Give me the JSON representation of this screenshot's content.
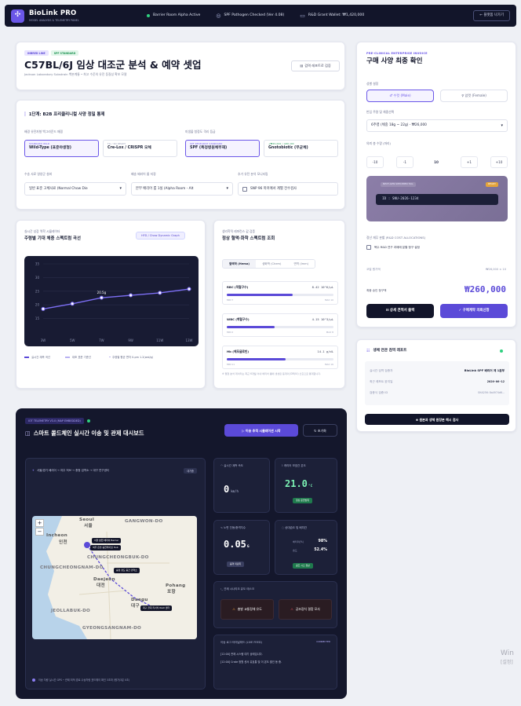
{
  "app": {
    "title": "BioLink PRO",
    "subtitle": "MODEL ANALYSIS & TELEMETRY PANEL",
    "status": [
      {
        "label": "Barrier Room Alpha Active",
        "icon": "status-dot"
      },
      {
        "label": "SPF Pathogen Checked (Ver 4.08)",
        "icon": "shield-check-icon"
      },
      {
        "label": "R&D Grant Wallet: ₩1,420,000",
        "icon": "wallet-icon"
      }
    ],
    "exit_label": "← 플랫폼 나가기"
  },
  "header": {
    "tags": [
      "INBRED LINE",
      "SPF STANDARD"
    ],
    "title": "C57BL/6J 임상 대조군 분석 & 예약 셋업",
    "subtitle": "Jackson Laboratory Substrain 백본계통 • 최고 수준의 유전 동질성 확보 모델",
    "report_button": "검역 레포트로 검증"
  },
  "step": {
    "title": "1단계: B2B 프리클리니컬 사양 정밀 통제",
    "genetic_label": "배경 유전자형 백그라운드 매핑",
    "genetic_options": [
      {
        "kicker": "STANDARD WILD",
        "value": "Wild-Type (표준야생형)",
        "selected": true
      },
      {
        "kicker": "TG / KO READY",
        "value": "Cre-Lox / CRISPR 모체",
        "selected": false
      }
    ],
    "micro_label": "미생물 청정도 격리 등급",
    "micro_options": [
      {
        "kicker": "SPF RESEARCH STANDARD",
        "value": "SPF (특정병원체부재)",
        "selected": true
      },
      {
        "kicker": "+₩45,000 / ADD-ON",
        "value": "Gnotobiotic (무균체)",
        "selected": false
      }
    ],
    "diet_label": "수송 사료 영양군 설비",
    "diet_value": "일반 표준 고체사료 (Normal Chow Die",
    "barrier_label": "배송 배리어 룸 지정",
    "barrier_value": "본부 배리어 룸 1실 (Alpha Room - Alt",
    "extra_label": "추가 유전 분석 모니터링",
    "extra_value": "SNP 96 마커에서 계별 전수검사"
  },
  "growth": {
    "kicker": "실시간 성장 역학 시뮬레이터",
    "title": "주령별 기대 체중 스펙트럼 곡선",
    "button": "HFD / Chow Dynamic Graph",
    "legend": [
      "실시간 계측 곡선",
      "대조 표준 기준선",
      "주령별 평균 편차 0-pm 1.2(wol/g)"
    ]
  },
  "chart_data": {
    "type": "line",
    "title": "주령별 기대 체중 스펙트럼 곡선",
    "x": [
      "3W",
      "5W",
      "7W",
      "9W",
      "11W",
      "13W"
    ],
    "y_ticks": [
      "35",
      "30",
      "25",
      "20",
      "15"
    ],
    "ylim": [
      10,
      35
    ],
    "series": [
      {
        "name": "실시간 계측 곡선",
        "values": [
          18.5,
          20.4,
          22.6,
          23.5,
          24.4,
          25.8
        ]
      }
    ],
    "annotation": "20.5g"
  },
  "blood": {
    "kicker": "생리학적 레퍼런스 값 검증",
    "title": "정상 혈액·화학 스펙트럼 조회",
    "tabs": [
      "혈액학 (Hema)",
      "생화학 (Chem)",
      "면역 (Imm)"
    ],
    "meters": [
      {
        "name": "RBC (적혈구수)",
        "value": "8.42 10^6/μL",
        "fraction": 0.62,
        "lo": "MIN 7",
        "hi": "MAX 10"
      },
      {
        "name": "WBC (백혈구수)",
        "value": "4.15 10^3/μL",
        "fraction": 0.45,
        "lo": "MIN 2",
        "hi": "MAX 8"
      },
      {
        "name": "Hb (헤모글로빈)",
        "value": "14.1 g/dL",
        "fraction": 0.55,
        "lo": "MIN 11",
        "hi": "MAX 16"
      }
    ],
    "note": "※ 혈청 분석 데이터는 최근 6개월 이내 배리어 룸에 생성된 동계의 JDR(IU) 산출으로 통계합니다."
  },
  "invoice": {
    "kicker": "PRE-CLINICAL ENTERPRISE INVOICE",
    "title": "구매 사양 최종 확인",
    "sex_label": "성별 설정",
    "sex_options": [
      "♂ 수컷 (Male)",
      "♀ 암컷 (Female)"
    ],
    "weight_label": "반입 주령 및 체중선택",
    "weight_value": "6주령 (체중 18g ~ 22g) - ₩26,000",
    "count_label": "의뢰 총 수량 (마리)",
    "steps": [
      "-10",
      "-1",
      "10",
      "+1",
      "+10"
    ],
    "preview_label": "NEXT-GEN SPECIMEN TAG",
    "preview_badge": "READY",
    "preview_code": "ID : SNU-2026-1234",
    "alloc_label": "정산 재무 분할 (R&D COST ALLOCATIONS)",
    "alloc_check": "복수 R&D 연구 과제에 분할 청구 설정",
    "unit_label": "코얼 원가액",
    "unit_value": "₩26,000 × 10",
    "total_label": "최종 승인 청구액",
    "total_value": "₩260,000",
    "print_button": "⊟ 상세 견적서 출력",
    "confirm_button": "✓ 구매계약 의뢰신청"
  },
  "verify": {
    "title": "생체 연관 검역 레포트",
    "rows": [
      {
        "k": "실시간 검역 검증자",
        "v": "BioLink SPF 배리어 제 1분부"
      },
      {
        "k": "최근 레포트 완지일",
        "v": "2026-06-12"
      },
      {
        "k": "검증식 검증 ID",
        "v": "SHA256: 8a4974d6..."
      }
    ],
    "button": "⊕ 원본과 생체 원장본 해시 검사"
  },
  "iot": {
    "tag": "IOT TELEMETRY V3.0 (MAP EMBEDDED)",
    "title": "스마트 콜드체인 실시간 이송 및 관제 대시보드",
    "start_button": "▷ 이송 추적 시뮬레이션 시작",
    "reset_button": "↻ 초기화",
    "route": "서울/경기 배리어 → 여주 허브 → 충청 검역소 → 대구 연구센터",
    "route_badge": "대기중",
    "map_labels": [
      "Seoul",
      "서울",
      "GANGWON-DO",
      "Incheon",
      "인천",
      "CHUNGCHEONGBUK-DO",
      "CHUNGCHEONGNAM-DO",
      "Daejeon",
      "대전",
      "Daegu",
      "대구",
      "Pohang",
      "포항",
      "JEOLLABUK-DO",
      "GYEONGSANGNAM-DO"
    ],
    "map_tags": [
      "서울 본원 배리어 Barrier",
      "여주 온습·충전터미널 Hub",
      "충청 청도 중간 검역소",
      "대구 클릭 리서치 R&D 센터"
    ],
    "footer": "이송 차량 실시간 GPS ─ 관제 최적 경로 수송차량 표드웨이 확인 3초마 (평가/3분 0초)",
    "speed_label": "실시간 계측 속도",
    "speed_value": "0",
    "speed_unit": "km/h",
    "temp_label": "캐리어 보호칸 온도",
    "temp_value": "21.0",
    "temp_unit": "°C",
    "temp_badge": "정상 운전범위",
    "fatigue_label": "노면 진동/충격지수",
    "fatigue_value": "0.05",
    "fatigue_unit": "G",
    "fatigue_badge": "충격 미감지",
    "humid_label": "상대습도 및 배치칸",
    "humid_rows": [
      {
        "k": "배터리(%)",
        "v": "98%"
      },
      {
        "k": "습도",
        "v": "52.4%"
      }
    ],
    "humid_badge": "공조 시스 정상",
    "scenario_label": "관제 시나리오 유도 테스크",
    "scenario_buttons": [
      "충발 교통정체 유도",
      "공조장치 결함 모사"
    ],
    "log_label": "이송 로그 터미널피드 (LIVE FEED)",
    "log_badge": "CONNECTED",
    "log_lines": [
      "[12:00] 관제 시스템 대기 상태입니다.",
      "[12:00] Crate 정원 센서 유효통 및 이 온도 출인 동 중."
    ]
  },
  "watermark": [
    "Win",
    "[설정]"
  ]
}
